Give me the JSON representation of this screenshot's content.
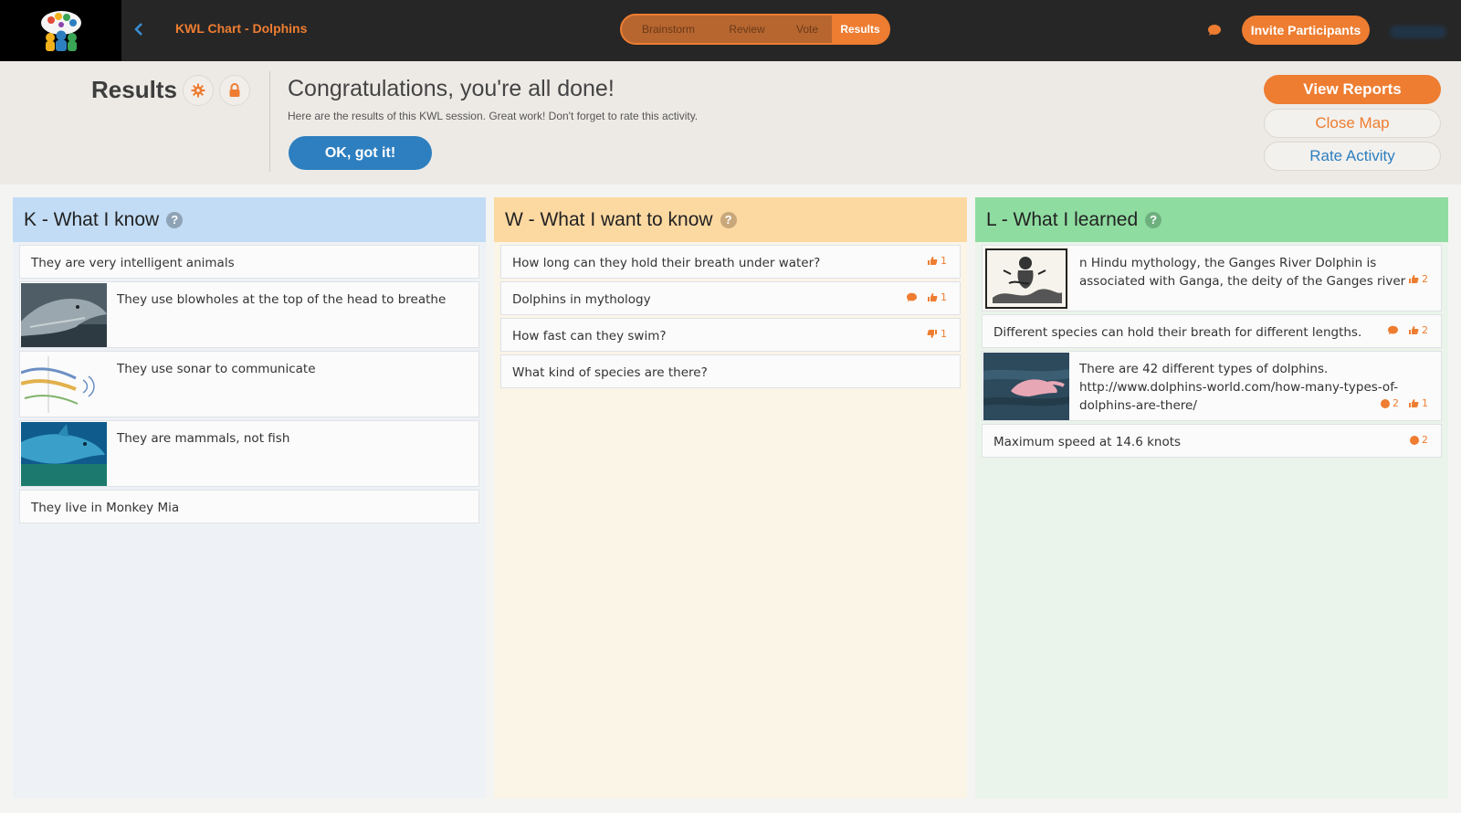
{
  "topbar": {
    "title": "KWL Chart - Dolphins",
    "steps": [
      "Brainstorm",
      "Review",
      "Vote",
      "Results"
    ],
    "invite_label": "Invite Participants"
  },
  "header": {
    "page_title": "Results",
    "congrats": "Congratulations, you're all done!",
    "subtext": "Here are the results of this KWL session. Great work! Don't forget to rate this activity.",
    "ok_label": "OK, got it!",
    "view_reports": "View Reports",
    "close_map": "Close Map",
    "rate_activity": "Rate Activity"
  },
  "columns": {
    "k": {
      "title": "K - What I know",
      "cards": [
        {
          "text": "They are very intelligent animals"
        },
        {
          "text": "They use blowholes at the top of the head to breathe"
        },
        {
          "text": "They use sonar to communicate"
        },
        {
          "text": "They are mammals, not fish"
        },
        {
          "text": "They live in Monkey Mia"
        }
      ]
    },
    "w": {
      "title": "W - What I want to know",
      "cards": [
        {
          "text": "How long can they hold their breath under water?",
          "votes": "1"
        },
        {
          "text": "Dolphins in mythology",
          "votes": "1"
        },
        {
          "text": "How fast can they swim?",
          "votes": "1"
        },
        {
          "text": "What kind of species are there?"
        }
      ]
    },
    "l": {
      "title": "L - What I learned",
      "cards": [
        {
          "text": "n Hindu mythology, the Ganges River Dolphin is associated with Ganga, the deity of the Ganges river",
          "votes": "2"
        },
        {
          "text": "Different species can hold their breath for different lengths.",
          "votes": "2"
        },
        {
          "text": "There are 42 different types of dolphins. http://www.dolphins-world.com/how-many-types-of-dolphins-are-there/",
          "comments": "2",
          "votes": "1"
        },
        {
          "text": "Maximum speed at 14.6 knots",
          "comments": "2"
        }
      ]
    }
  },
  "colors": {
    "accent": "#ee7d31",
    "primary_blue": "#2d7fc0",
    "k_header": "#c2dcf5",
    "w_header": "#fdd9a2",
    "l_header": "#8fdca0"
  },
  "icons": [
    "app-logo-icon",
    "back-chevron-icon",
    "chat-bubble-icon",
    "gear-icon",
    "lock-icon",
    "help-icon",
    "thumbs-up-icon",
    "thumbs-down-icon",
    "comment-icon",
    "dot-icon"
  ]
}
